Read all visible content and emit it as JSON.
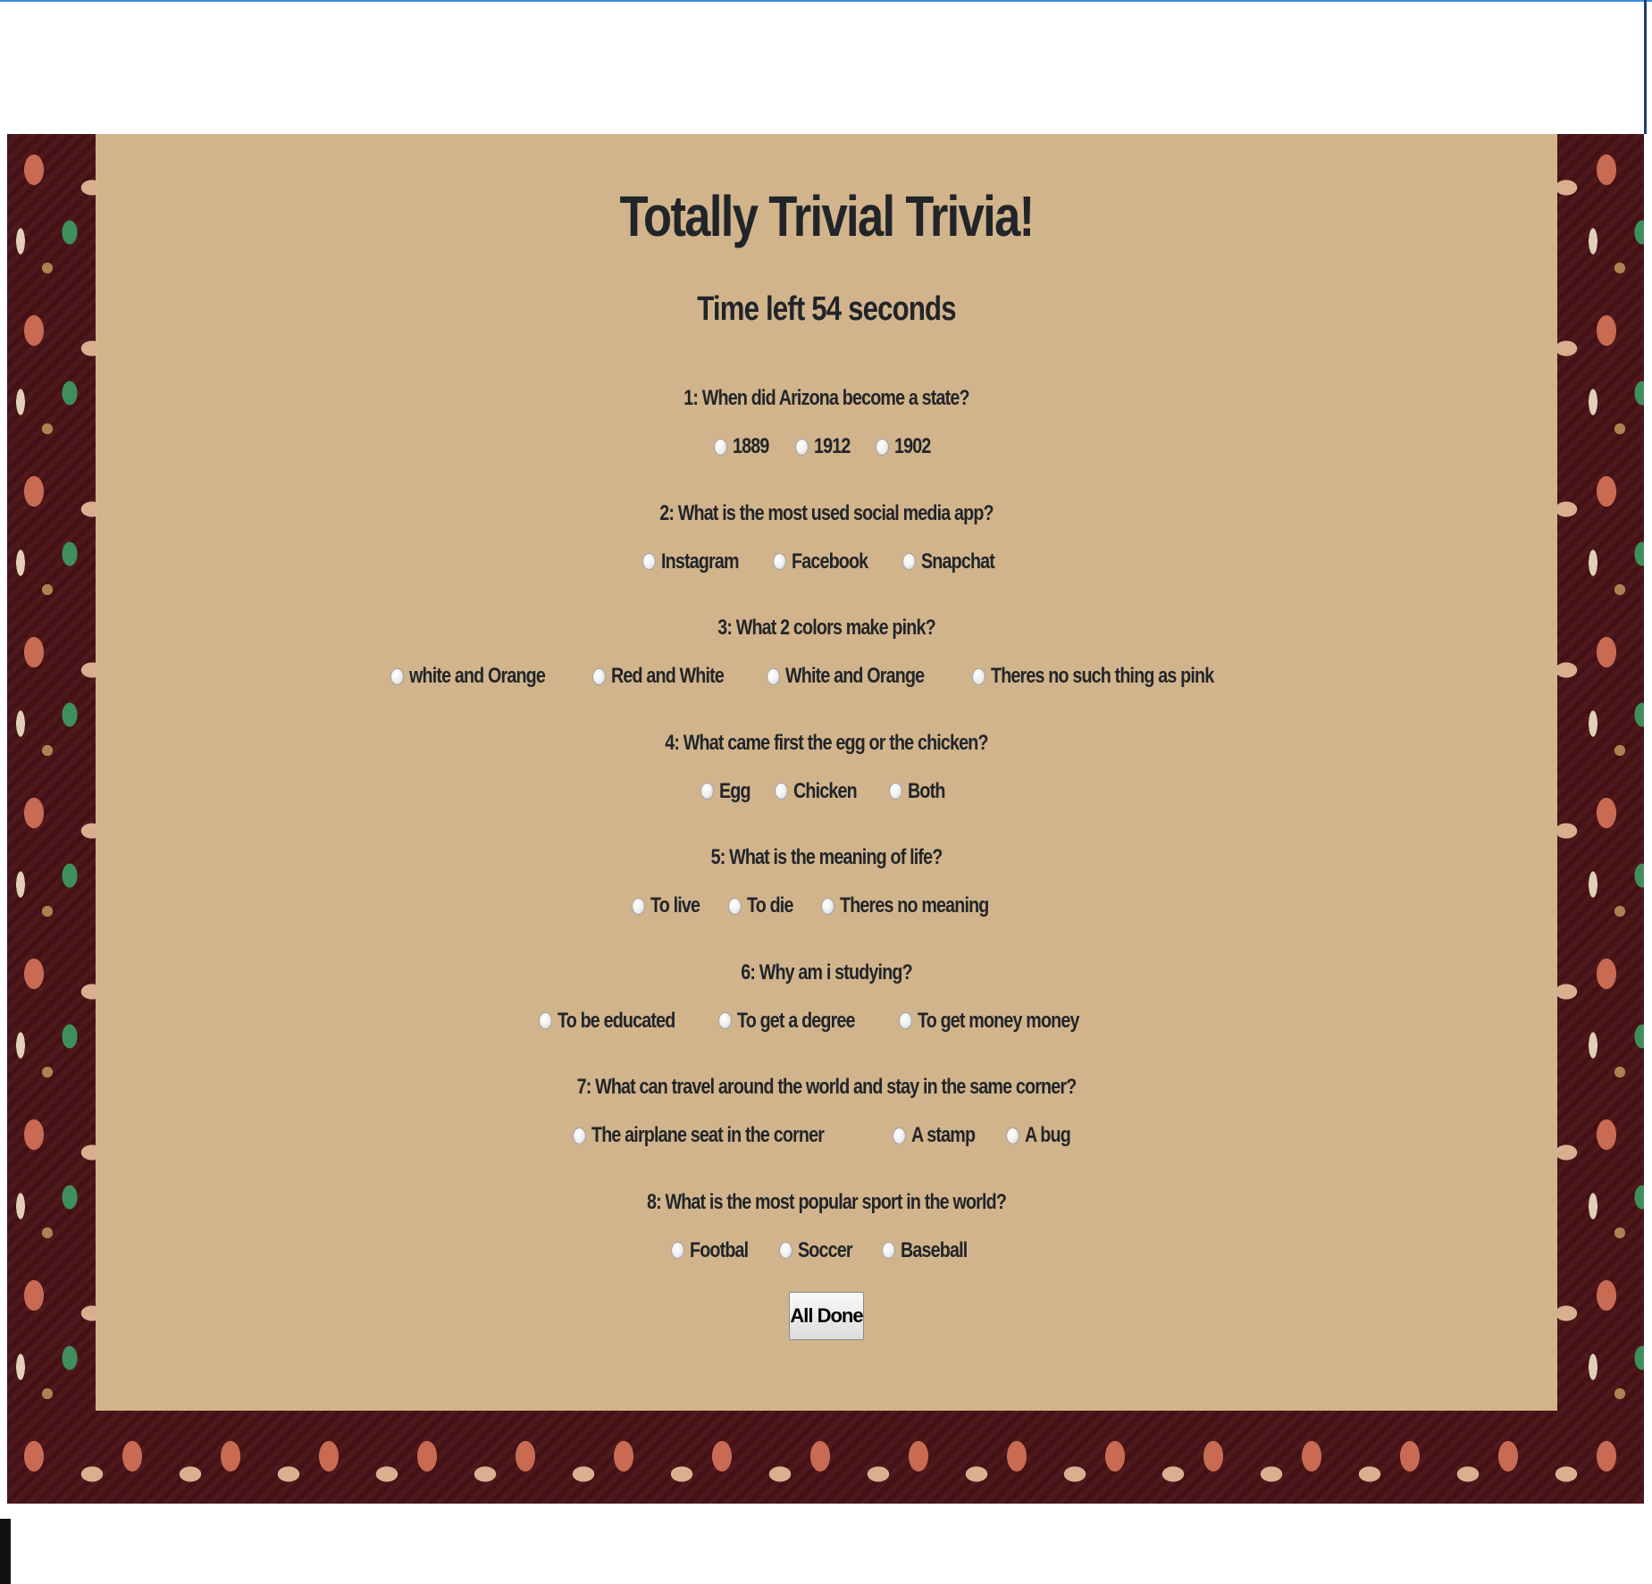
{
  "page": {
    "title": "Totally Trivial Trivia!",
    "timer_text": "Time left 54 seconds"
  },
  "questions": [
    {
      "text": "1: When did Arizona become a state?",
      "options": [
        "1889",
        "1912",
        "1902"
      ]
    },
    {
      "text": "2: What is the most used social media app?",
      "options": [
        "Instagram",
        "Facebook",
        "Snapchat"
      ]
    },
    {
      "text": "3: What 2 colors make pink?",
      "options": [
        "white and Orange",
        "Red and White",
        "White and Orange",
        "Theres no such thing as pink"
      ]
    },
    {
      "text": "4: What came first the egg or the chicken?",
      "options": [
        "Egg",
        "Chicken",
        "Both"
      ]
    },
    {
      "text": "5: What is the meaning of life?",
      "options": [
        "To live",
        "To die",
        "Theres no meaning"
      ]
    },
    {
      "text": "6: Why am i studying?",
      "options": [
        "To be educated",
        "To get a degree",
        "To get money money"
      ]
    },
    {
      "text": "7: What can travel around the world and stay in the same corner?",
      "options": [
        "The airplane seat in the corner",
        "A stamp",
        "A bug"
      ]
    },
    {
      "text": "8: What is the most popular sport in the world?",
      "options": [
        "Footbal",
        "Soccer",
        "Baseball"
      ]
    }
  ],
  "submit": {
    "label": "All Done"
  },
  "colors": {
    "panel": "#d2b48c",
    "text": "#212529",
    "wallpaper": "#4a1418"
  }
}
